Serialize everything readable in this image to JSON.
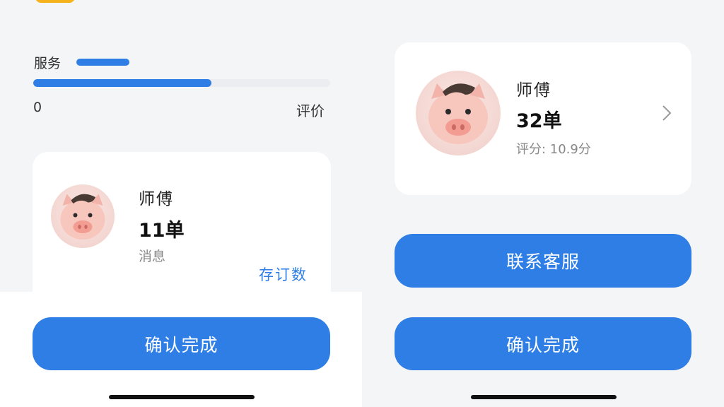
{
  "progress": {
    "title": "服务",
    "start_label": "0",
    "end_label": "评价",
    "fill_percent": 60
  },
  "left_card": {
    "name": "师傅",
    "count": "11单",
    "sub_label": "消息",
    "link_label": "存订数",
    "avatar_icon": "pig-avatar-icon"
  },
  "right_card": {
    "name": "师傅",
    "count": "32单",
    "sub_label": "评分: 10.9分",
    "avatar_icon": "pig-avatar-icon",
    "chevron_icon": "chevron-right-icon"
  },
  "buttons": {
    "confirm_left": "确认完成",
    "contact_service": "联系客服",
    "confirm_right": "确认完成"
  },
  "colors": {
    "accent": "#2f7ee6",
    "badge": "#f6b21b",
    "background": "#f4f5f7"
  }
}
